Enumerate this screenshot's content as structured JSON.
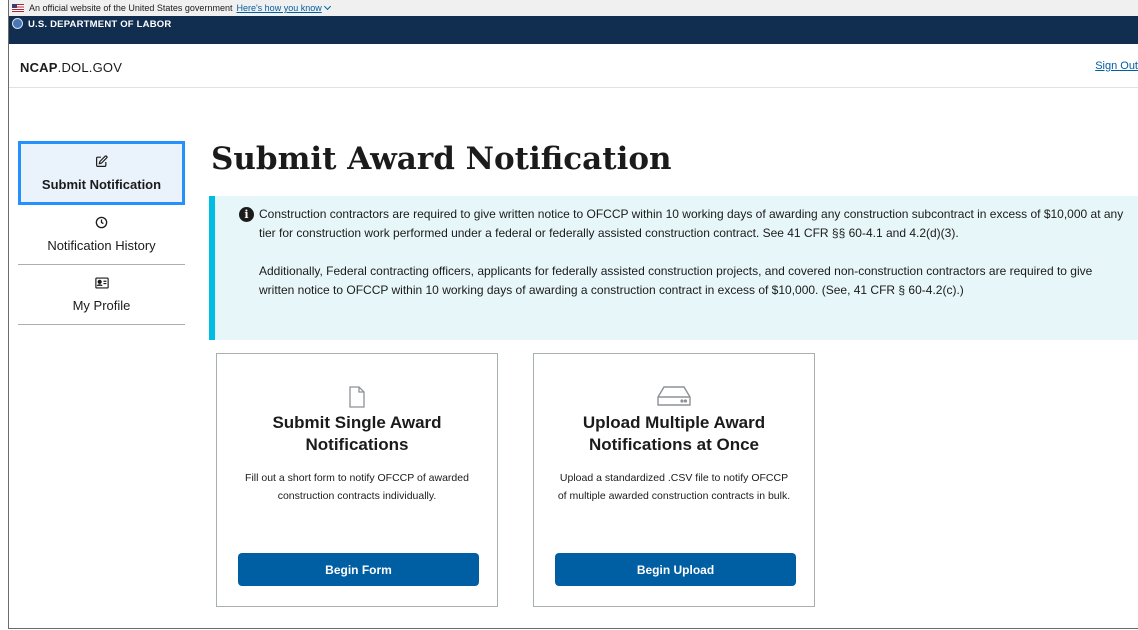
{
  "gov_banner": {
    "text": "An official website of the United States government",
    "link": "Here's how you know"
  },
  "agency_bar": {
    "name": "U.S. DEPARTMENT OF LABOR"
  },
  "header": {
    "logo_bold": "NCAP",
    "logo_rest": ".DOL.GOV",
    "sign_out": "Sign Out"
  },
  "sidebar": {
    "items": [
      {
        "label": "Submit Notification",
        "icon": "edit-icon",
        "active": true
      },
      {
        "label": "Notification History",
        "icon": "clock-icon",
        "active": false
      },
      {
        "label": "My Profile",
        "icon": "id-card-icon",
        "active": false
      }
    ]
  },
  "main": {
    "title": "Submit Award Notification",
    "alert": {
      "icon": "info-icon",
      "paragraphs": [
        "Construction contractors are required to give written notice to OFCCP within 10 working days of awarding any construction subcontract in excess of $10,000 at any tier for construction work performed under a federal or federally assisted construction contract. See 41 CFR §§ 60-4.1 and 4.2(d)(3).",
        "Additionally, Federal contracting officers, applicants for federally assisted construction projects, and covered non-construction contractors are required to give written notice to OFCCP within 10 working days of awarding a construction contract in excess of $10,000. (See, 41 CFR § 60-4.2(c).)"
      ]
    },
    "cards": [
      {
        "icon": "file-icon",
        "title": "Submit Single Award Notifications",
        "description": "Fill out a short form to notify OFCCP of awarded construction contracts individually.",
        "button": "Begin Form"
      },
      {
        "icon": "hard-drive-icon",
        "title": "Upload Multiple Award Notifications at Once",
        "description": "Upload a standardized .CSV file to notify OFCCP of multiple awarded construction contracts in bulk.",
        "button": "Begin Upload"
      }
    ]
  },
  "colors": {
    "primary": "#005ea2",
    "agency_bar": "#112e51",
    "alert_bg": "#e7f6f8",
    "alert_border": "#00bde3",
    "active_nav_border": "#2491ff"
  }
}
